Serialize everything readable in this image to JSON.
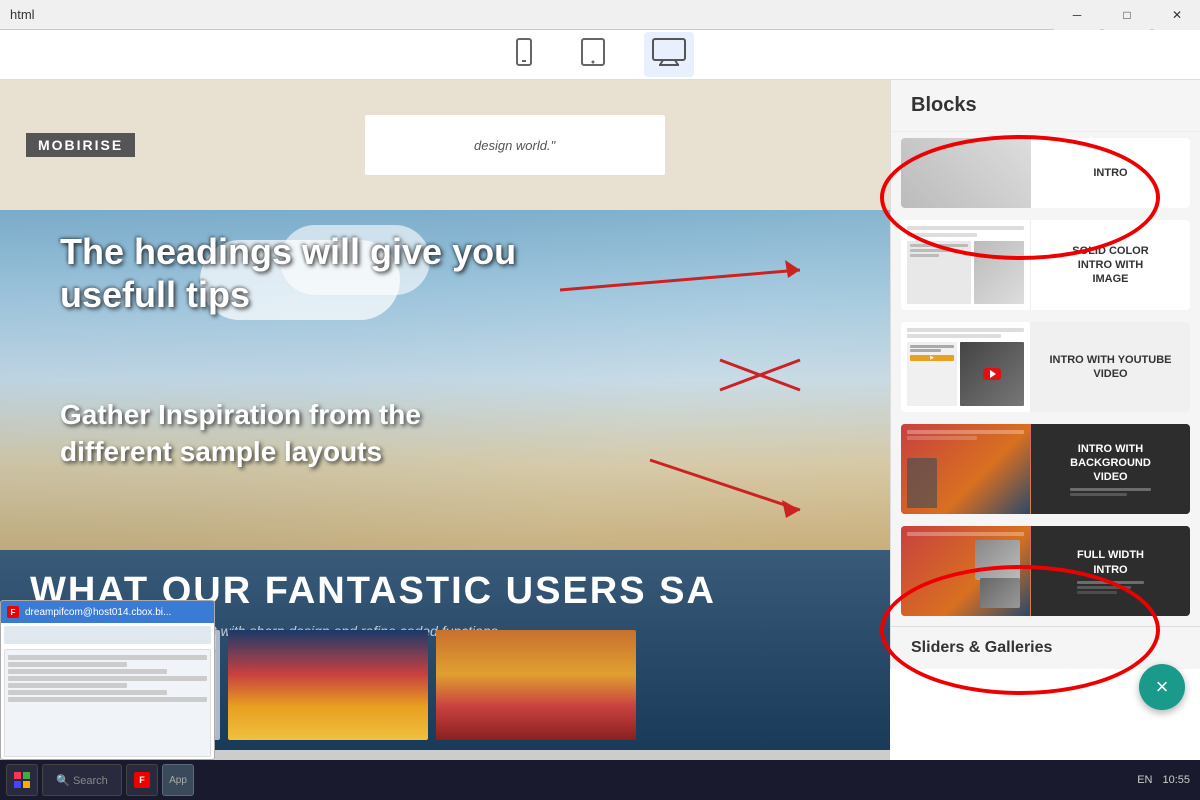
{
  "titlebar": {
    "text": "html",
    "minimize": "─",
    "maximize": "□",
    "close": "✕"
  },
  "toolbar": {
    "devices": [
      {
        "icon": "📱",
        "label": "mobile",
        "active": false
      },
      {
        "icon": "⬜",
        "label": "tablet",
        "active": false
      },
      {
        "icon": "🖥",
        "label": "desktop",
        "active": true
      }
    ]
  },
  "sidebar": {
    "title": "Blocks",
    "blocks": [
      {
        "id": "solid-color",
        "label": "SOLID COLOR INTRO WITH IMAGE",
        "circled": true
      },
      {
        "id": "youtube",
        "label": "INTRO WITH YOUTUBE VIDEO",
        "circled": false
      },
      {
        "id": "bg-video",
        "label": "INTRO WITH BACKGROUND VIDEO",
        "circled": false
      },
      {
        "id": "fullwidth",
        "label": "FULL WIDTH INTRO",
        "circled": true
      }
    ],
    "sections_title": "Sliders & Galleries"
  },
  "canvas": {
    "logo": "MOBIRISE",
    "quote": "design world.\"",
    "heading_tip": "The headings will give you usefull tips",
    "inspiration_tip": "Gather Inspiration from the different sample layouts",
    "banner_text": "WHAT OUR FANTASTIC USERS SA",
    "banner_sub": "Shape your future web project with sharp design and refine coded functions."
  },
  "chat_window": {
    "title": "dreampifcom@host014.cbox.bi...",
    "icon": "F"
  },
  "taskbar": {
    "time": "10:55",
    "locale": "EN"
  },
  "fab": {
    "icon": "×"
  }
}
